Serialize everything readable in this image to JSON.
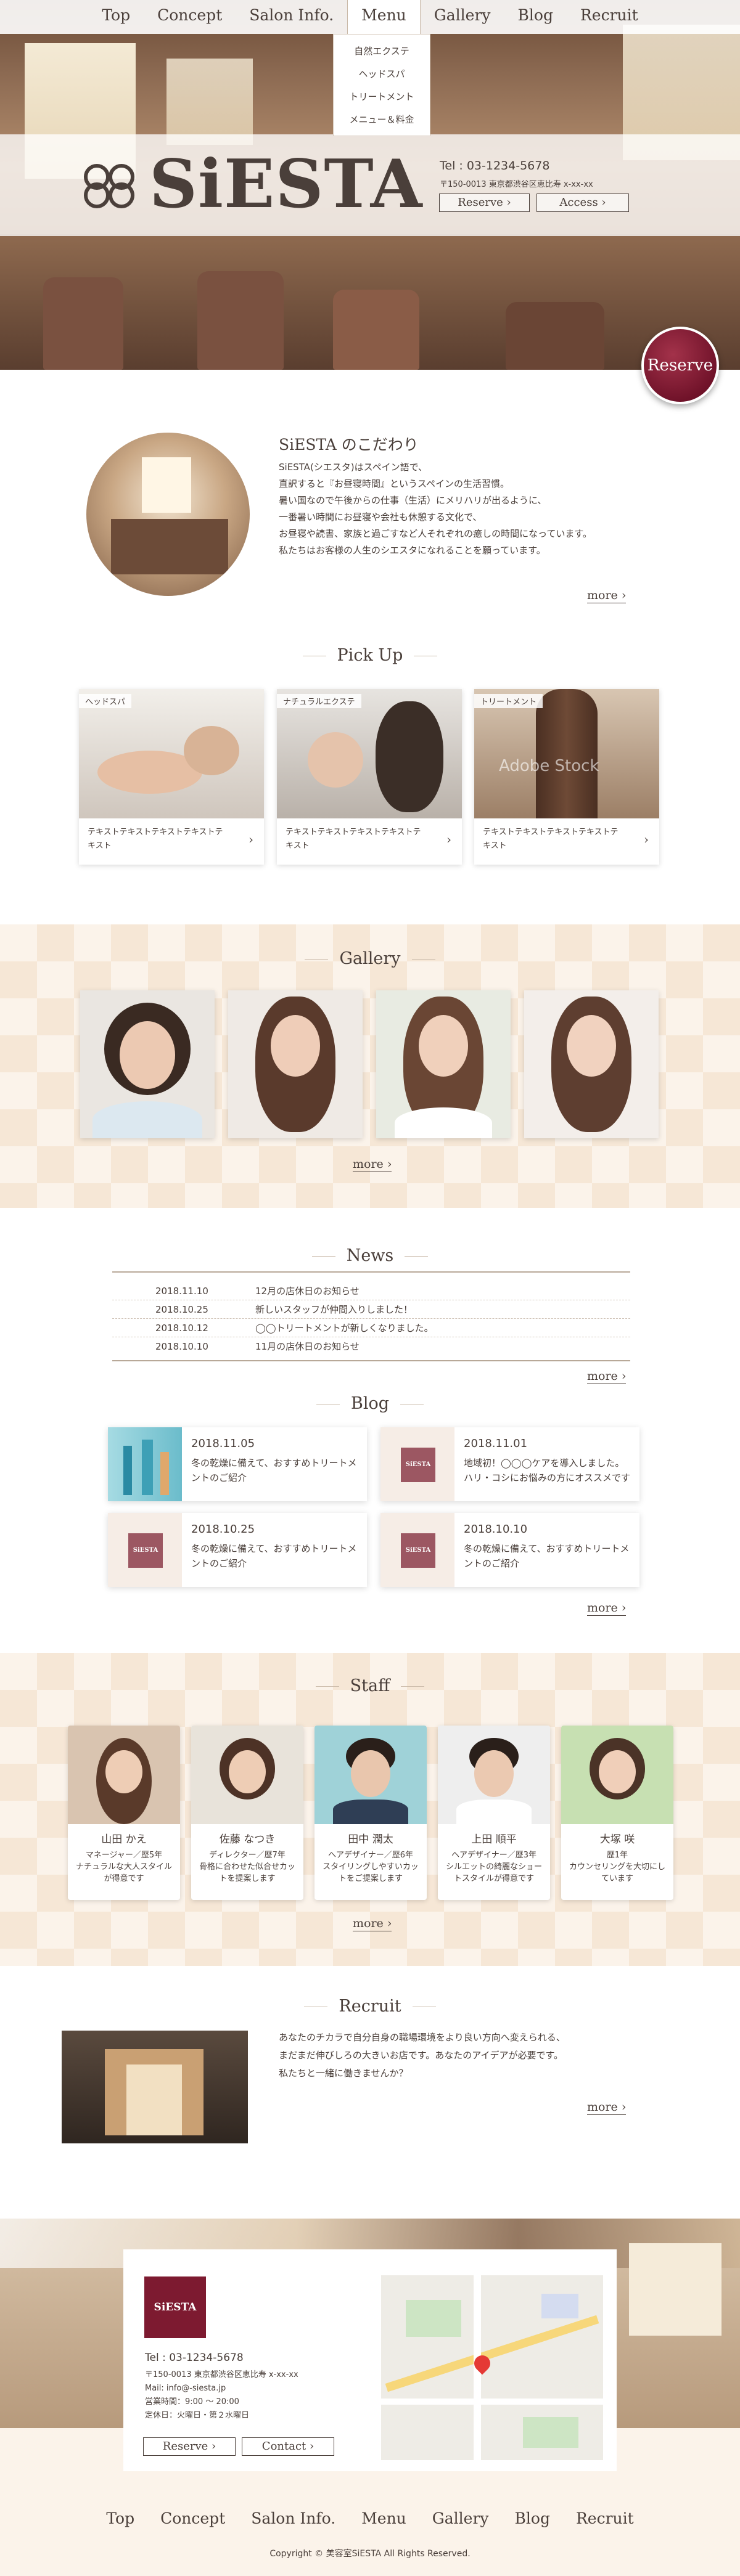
{
  "nav": {
    "items": [
      "Top",
      "Concept",
      "Salon Info.",
      "Menu",
      "Gallery",
      "Blog",
      "Recruit"
    ],
    "dropdown": [
      "自然エクステ",
      "ヘッドスパ",
      "トリートメント",
      "メニュー＆料金"
    ]
  },
  "hero": {
    "brand": "SiESTA",
    "tel": "Tel : 03-1234-5678",
    "address": "〒150-0013 東京都渋谷区恵比寿 x-xx-xx",
    "reserve": "Reserve",
    "access": "Access",
    "reserve_badge": "Reserve"
  },
  "concept": {
    "title": "SiESTA のこだわり",
    "lines": [
      "SiESTA(シエスタ)はスペイン語で、",
      "直訳すると『お昼寝時間』というスペインの生活習慣。",
      "暑い国なので午後からの仕事（生活）にメリハリが出るように、",
      "一番暑い時間にお昼寝や会社も休憩する文化で、",
      "お昼寝や読書、家族と過ごすなど人それぞれの癒しの時間になっています。",
      "私たちはお客様の人生のシエスタになれることを願っています。"
    ],
    "more": "more"
  },
  "pickup": {
    "title": "Pick Up",
    "cards": [
      {
        "tag": "ヘッドスパ",
        "text": "テキストテキストテキストテキストテキスト"
      },
      {
        "tag": "ナチュラルエクステ",
        "text": "テキストテキストテキストテキストテキスト"
      },
      {
        "tag": "トリートメント",
        "text": "テキストテキストテキストテキストテキスト",
        "watermark": "Adobe Stock"
      }
    ]
  },
  "gallery": {
    "title": "Gallery",
    "more": "more"
  },
  "news": {
    "title": "News",
    "items": [
      {
        "date": "2018.11.10",
        "text": "12月の店休日のお知らせ"
      },
      {
        "date": "2018.10.25",
        "text": "新しいスタッフが仲間入りしました！"
      },
      {
        "date": "2018.10.12",
        "text": "◯◯トリートメントが新しくなりました。"
      },
      {
        "date": "2018.10.10",
        "text": "11月の店休日のお知らせ"
      }
    ],
    "more": "more"
  },
  "blog": {
    "title": "Blog",
    "logo_tile": "SiESTA",
    "posts": [
      {
        "date": "2018.11.05",
        "text": "冬の乾燥に備えて、おすすめトリートメントのご紹介"
      },
      {
        "date": "2018.11.01",
        "text": "地域初！◯◯◯ケアを導入しました。ハリ・コシにお悩みの方にオススメです"
      },
      {
        "date": "2018.10.25",
        "text": "冬の乾燥に備えて、おすすめトリートメントのご紹介"
      },
      {
        "date": "2018.10.10",
        "text": "冬の乾燥に備えて、おすすめトリートメントのご紹介"
      }
    ],
    "more": "more"
  },
  "staff": {
    "title": "Staff",
    "members": [
      {
        "name": "山田 かえ",
        "role": "マネージャー／歴5年",
        "desc": "ナチュラルな大人スタイルが得意です"
      },
      {
        "name": "佐藤 なつき",
        "role": "ディレクター／歴7年",
        "desc": "骨格に合わせた似合せカットを提案します"
      },
      {
        "name": "田中 潤太",
        "role": "ヘアデザイナー／歴6年",
        "desc": "スタイリングしやすいカットをご提案します"
      },
      {
        "name": "上田 順平",
        "role": "ヘアデザイナー／歴3年",
        "desc": "シルエットの綺麗なショートスタイルが得意です"
      },
      {
        "name": "大塚 咲",
        "role": "歴1年",
        "desc": "カウンセリングを大切にしています"
      }
    ],
    "more": "more"
  },
  "recruit": {
    "title": "Recruit",
    "lines": [
      "あなたのチカラで自分自身の職場環境をより良い方向へ変えられる、",
      "まだまだ伸びしろの大きいお店です。あなたのアイデアが必要です。",
      "私たちと一緒に働きませんか？"
    ],
    "more": "more"
  },
  "footer": {
    "logo": "SiESTA",
    "tel": "Tel : 03-1234-5678",
    "address": "〒150-0013 東京都渋谷区恵比寿 x-xx-xx",
    "mail": "Mail: info@-siesta.jp",
    "hours": "営業時間：9:00 〜 20:00",
    "holiday": "定休日：火曜日・第２水曜日",
    "reserve": "Reserve",
    "contact": "Contact",
    "copyright": "Copyright © 美容室SiESTA All Rights Reserved."
  },
  "colors": {
    "accent": "#7d1a30",
    "text": "#4a3f3a",
    "beige": "#fbf3ea"
  }
}
